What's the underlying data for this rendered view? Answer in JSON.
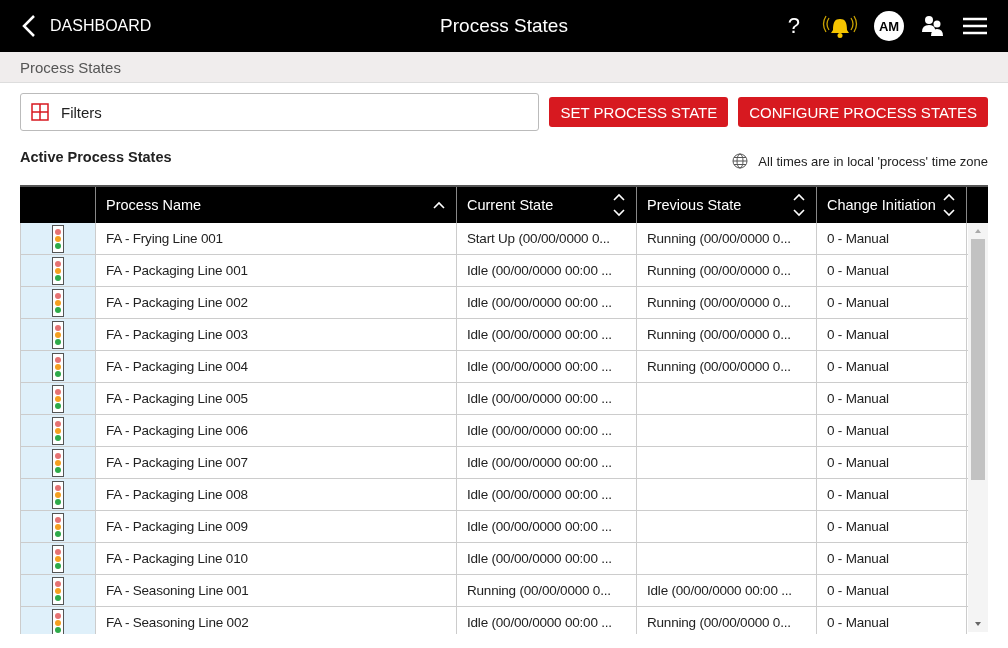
{
  "header": {
    "back_label": "DASHBOARD",
    "title": "Process States",
    "help": "?",
    "avatar": "AM"
  },
  "breadcrumb": "Process States",
  "filters": {
    "label": "Filters"
  },
  "buttons": [
    "SET PROCESS STATE",
    "CONFIGURE PROCESS STATES"
  ],
  "section_title": "Active Process States",
  "timezone_note": "All times are in local 'process' time zone",
  "table": {
    "columns": [
      {
        "label": "Process Name",
        "sorted": true
      },
      {
        "label": "Current State",
        "sorted": false
      },
      {
        "label": "Previous State",
        "sorted": false
      },
      {
        "label": "Change Initiation",
        "sorted": false
      }
    ],
    "rows": [
      {
        "name": "FA - Frying Line 001",
        "current": "Start Up (00/00/0000 0...",
        "previous": "Running (00/00/0000 0...",
        "initiation": "0 - Manual"
      },
      {
        "name": "FA - Packaging Line 001",
        "current": "Idle (00/00/0000 00:00 ...",
        "previous": "Running (00/00/0000 0...",
        "initiation": "0 - Manual"
      },
      {
        "name": "FA - Packaging Line 002",
        "current": "Idle (00/00/0000 00:00 ...",
        "previous": "Running (00/00/0000 0...",
        "initiation": "0 - Manual"
      },
      {
        "name": "FA - Packaging Line 003",
        "current": "Idle (00/00/0000 00:00 ...",
        "previous": "Running (00/00/0000 0...",
        "initiation": "0 - Manual"
      },
      {
        "name": "FA - Packaging Line 004",
        "current": "Idle (00/00/0000 00:00 ...",
        "previous": "Running (00/00/0000 0...",
        "initiation": "0 - Manual"
      },
      {
        "name": "FA - Packaging Line 005",
        "current": "Idle (00/00/0000 00:00 ...",
        "previous": "",
        "initiation": "0 - Manual"
      },
      {
        "name": "FA - Packaging Line 006",
        "current": "Idle (00/00/0000 00:00 ...",
        "previous": "",
        "initiation": "0 - Manual"
      },
      {
        "name": "FA - Packaging Line 007",
        "current": "Idle (00/00/0000 00:00 ...",
        "previous": "",
        "initiation": "0 - Manual"
      },
      {
        "name": "FA - Packaging Line 008",
        "current": "Idle (00/00/0000 00:00 ...",
        "previous": "",
        "initiation": "0 - Manual"
      },
      {
        "name": "FA - Packaging Line 009",
        "current": "Idle (00/00/0000 00:00 ...",
        "previous": "",
        "initiation": "0 - Manual"
      },
      {
        "name": "FA - Packaging Line 010",
        "current": "Idle (00/00/0000 00:00 ...",
        "previous": "",
        "initiation": "0 - Manual"
      },
      {
        "name": "FA - Seasoning Line 001",
        "current": "Running (00/00/0000 0...",
        "previous": "Idle (00/00/0000 00:00 ...",
        "initiation": "0 - Manual"
      },
      {
        "name": "FA - Seasoning Line 002",
        "current": "Idle (00/00/0000 00:00 ...",
        "previous": "Running (00/00/0000 0...",
        "initiation": "0 - Manual"
      }
    ]
  }
}
